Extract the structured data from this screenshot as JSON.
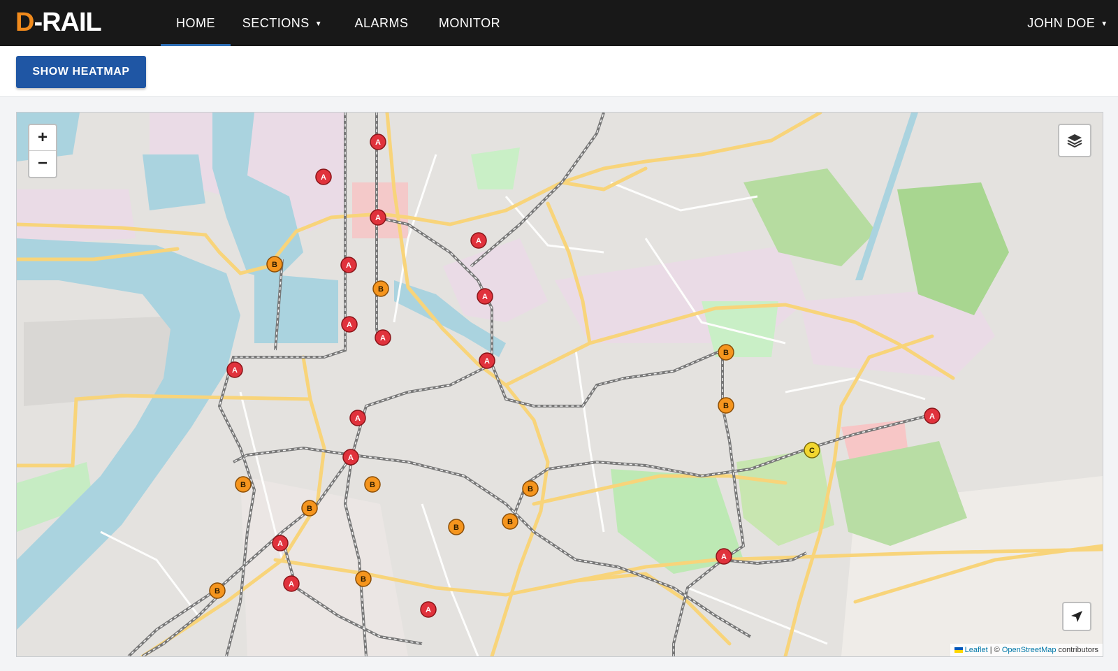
{
  "app": {
    "logo_text": "D-RAIL",
    "logo_d": "D",
    "logo_rest": "-RAIL"
  },
  "nav": {
    "home": "HOME",
    "sections": "SECTIONS",
    "alarms": "ALARMS",
    "monitor": "MONITOR",
    "user": "JOHN DOE",
    "caret": "▼"
  },
  "toolbar": {
    "heatmap_label": "SHOW HEATMAP"
  },
  "map": {
    "zoom_in": "+",
    "zoom_out": "−",
    "layers_icon": "layers-icon",
    "locate_icon": "locate-arrow-icon",
    "attribution_leaflet": "Leaflet",
    "attribution_sep": " | © ",
    "attribution_osm": "OpenStreetMap",
    "attribution_suffix": " contributors",
    "marker_colors": {
      "A": "#e0323c",
      "B": "#f5951e",
      "C": "#f2d630"
    }
  }
}
